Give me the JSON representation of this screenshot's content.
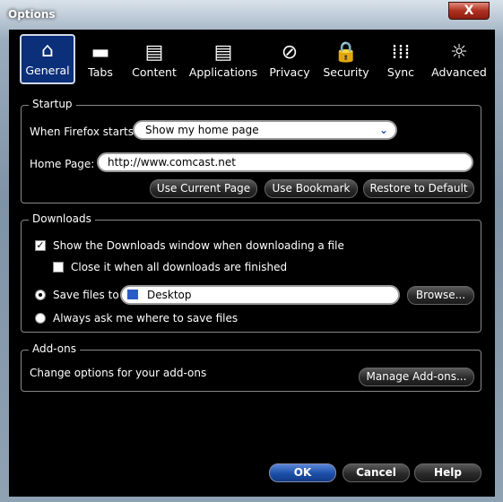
{
  "window": {
    "title": "Options",
    "close": "X"
  },
  "toolbar": [
    {
      "label": "General",
      "icon": "home-icon",
      "glyph": "⌂",
      "selected": true
    },
    {
      "label": "Tabs",
      "icon": "tabs-icon",
      "glyph": "▬"
    },
    {
      "label": "Content",
      "icon": "content-icon",
      "glyph": "▤"
    },
    {
      "label": "Applications",
      "icon": "applications-icon",
      "glyph": "▤"
    },
    {
      "label": "Privacy",
      "icon": "privacy-icon",
      "glyph": "⊘"
    },
    {
      "label": "Security",
      "icon": "lock-icon",
      "glyph": "🔒"
    },
    {
      "label": "Sync",
      "icon": "sync-icon",
      "glyph": "⁞⁞⁞"
    },
    {
      "label": "Advanced",
      "icon": "gear-icon",
      "glyph": "☼"
    }
  ],
  "startup": {
    "legend": "Startup",
    "when_label": "When Firefox starts:",
    "when_value": "Show my home page",
    "home_label": "Home Page:",
    "home_value": "http://www.comcast.net",
    "btn_current": "Use Current Page",
    "btn_bookmark": "Use Bookmark",
    "btn_restore": "Restore to Default"
  },
  "downloads": {
    "legend": "Downloads",
    "show_window": "Show the Downloads window when downloading a file",
    "show_window_checked": true,
    "close_it": "Close it when all downloads are finished",
    "close_it_checked": false,
    "save_to": "Save files to",
    "save_location": "Desktop",
    "browse": "Browse...",
    "always_ask": "Always ask me where to save files",
    "selected": "save_to"
  },
  "addons": {
    "legend": "Add-ons",
    "text": "Change options for your add-ons",
    "manage": "Manage Add-ons..."
  },
  "footer": {
    "ok": "OK",
    "cancel": "Cancel",
    "help": "Help"
  },
  "colors": {
    "ok_button": "#1c4fa8",
    "selected_tab": "#0c2f7a"
  }
}
